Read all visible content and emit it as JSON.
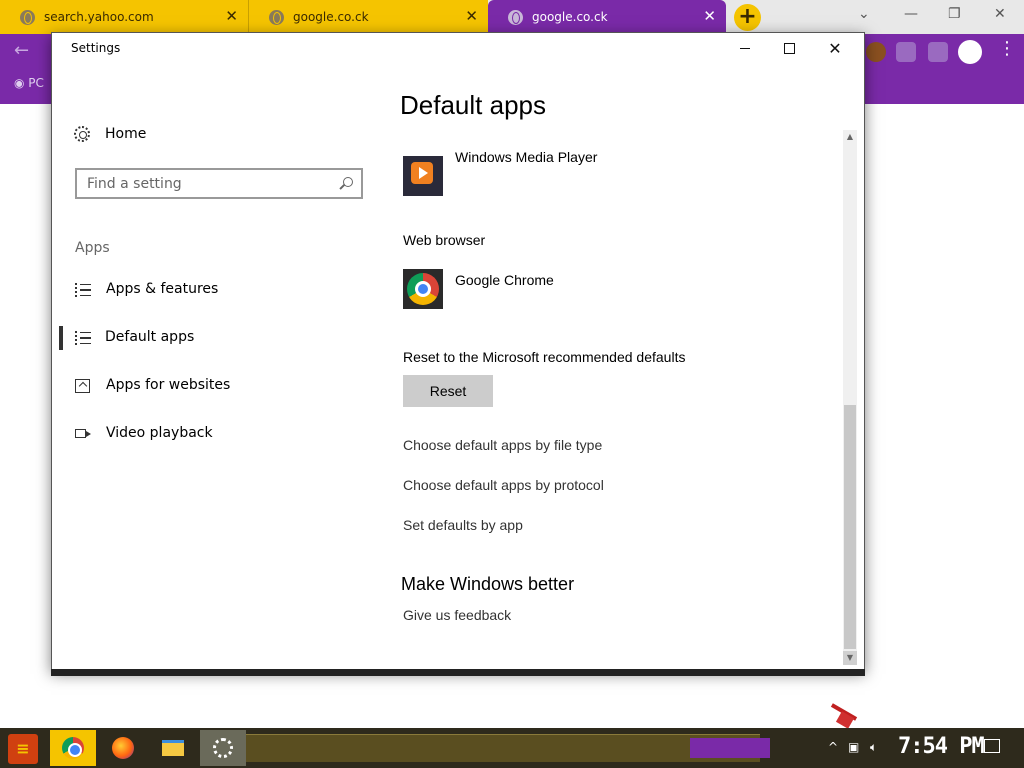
{
  "browser": {
    "tabs": [
      {
        "label": "search.yahoo.com"
      },
      {
        "label": "google.co.ck"
      },
      {
        "label": "google.co.ck"
      }
    ],
    "new_tab_label": "+",
    "bookmark_partial": "PC",
    "window_controls": {
      "minimize": "—",
      "restore": "❐",
      "close": "✕",
      "chevron": "⌄"
    }
  },
  "settings": {
    "window_title": "Settings",
    "close_glyph": "✕",
    "left": {
      "home_label": "Home",
      "search_placeholder": "Find a setting",
      "section_label": "Apps",
      "nav_items": [
        {
          "label": "Apps & features",
          "icon": "apps-features-icon"
        },
        {
          "label": "Default apps",
          "icon": "default-apps-icon",
          "selected": true
        },
        {
          "label": "Apps for websites",
          "icon": "apps-websites-icon"
        },
        {
          "label": "Video playback",
          "icon": "video-playback-icon"
        }
      ]
    },
    "main": {
      "title": "Default apps",
      "video_player_app": "Windows Media Player",
      "web_browser_label": "Web browser",
      "web_browser_app": "Google Chrome",
      "reset_label": "Reset to the Microsoft recommended defaults",
      "reset_button": "Reset",
      "links": [
        "Choose default apps by file type",
        "Choose default apps by protocol",
        "Set defaults by app"
      ],
      "make_better_title": "Make Windows better",
      "feedback_link": "Give us feedback"
    }
  },
  "taskbar": {
    "clock": "7:54 PM",
    "tray_chevron": "^"
  }
}
